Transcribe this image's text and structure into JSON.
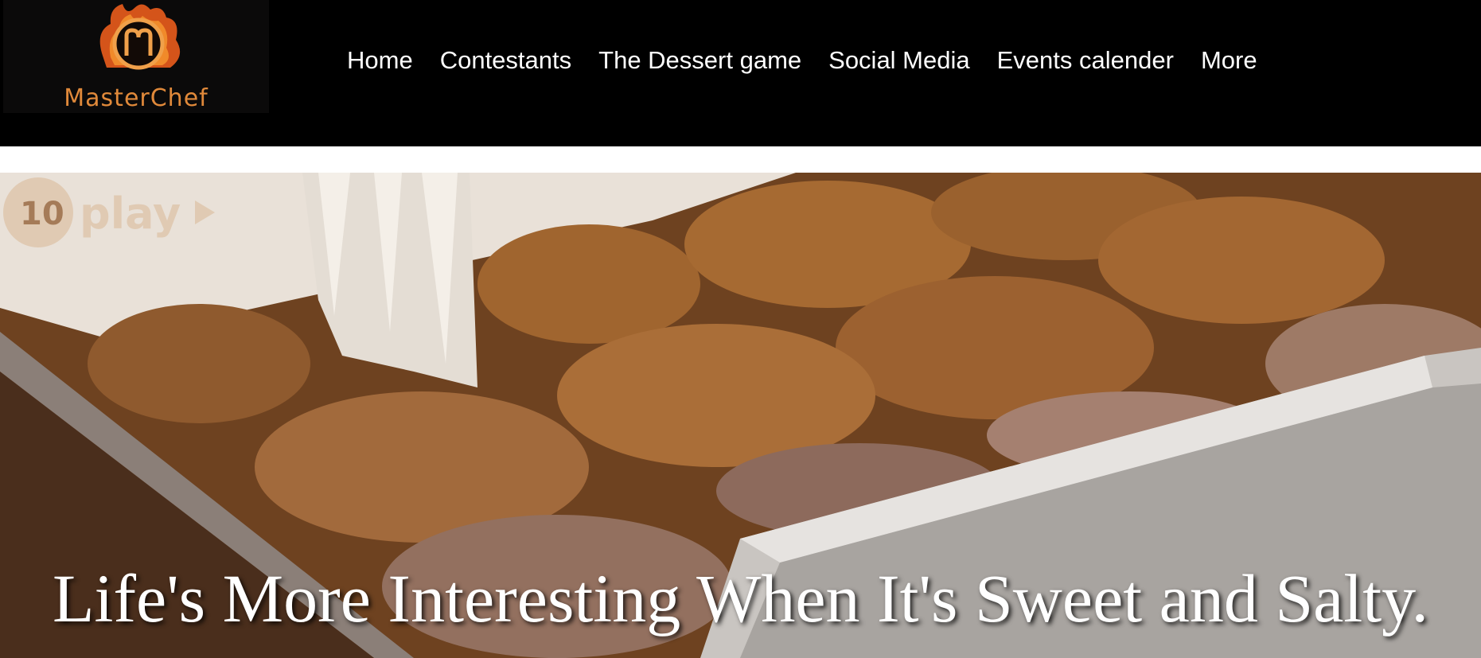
{
  "logo": {
    "text": "MasterChef"
  },
  "nav": {
    "items": [
      "Home",
      "Contestants",
      "The Dessert game",
      "Social Media",
      "Events calender",
      "More"
    ]
  },
  "hero": {
    "heading": "Life's More Interesting When It's Sweet and Salty.",
    "watermark": "play"
  },
  "colors": {
    "header_bg": "#000000",
    "logo_accent": "#e0893a",
    "nav_text": "#ffffff"
  }
}
